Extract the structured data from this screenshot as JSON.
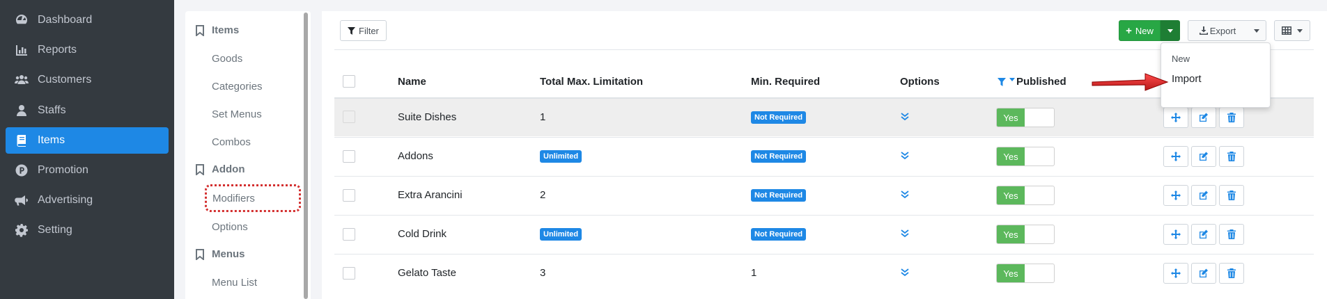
{
  "sidebar": {
    "items": [
      {
        "label": "Dashboard",
        "icon": "dashboard-icon"
      },
      {
        "label": "Reports",
        "icon": "bar-chart-icon"
      },
      {
        "label": "Customers",
        "icon": "users-icon"
      },
      {
        "label": "Staffs",
        "icon": "staff-icon"
      },
      {
        "label": "Items",
        "icon": "book-icon"
      },
      {
        "label": "Promotion",
        "icon": "promotion-icon"
      },
      {
        "label": "Advertising",
        "icon": "megaphone-icon"
      },
      {
        "label": "Setting",
        "icon": "gear-icon"
      }
    ],
    "active": "Items",
    "active_color": "#1e88e5"
  },
  "submenu": {
    "sections": [
      {
        "header": "Items",
        "items": [
          "Goods",
          "Categories",
          "Set Menus",
          "Combos"
        ]
      },
      {
        "header": "Addon",
        "items": [
          "Modifiers",
          "Options"
        ]
      },
      {
        "header": "Menus",
        "items": [
          "Menu List"
        ]
      }
    ],
    "highlighted": "Modifiers"
  },
  "toolbar": {
    "filter_label": "Filter",
    "new_label": "New",
    "export_label": "Export"
  },
  "new_dropdown": {
    "items": [
      "New",
      "Import"
    ]
  },
  "table": {
    "columns": [
      "Name",
      "Total Max. Limitation",
      "Min. Required",
      "Options",
      "Published"
    ],
    "rows": [
      {
        "name": "Suite Dishes",
        "max_limit": "1",
        "min_required": "Not Required",
        "published": "Yes"
      },
      {
        "name": "Addons",
        "max_limit": "Unlimited",
        "min_required": "Not Required",
        "published": "Yes"
      },
      {
        "name": "Extra Arancini",
        "max_limit": "2",
        "min_required": "Not Required",
        "published": "Yes"
      },
      {
        "name": "Cold Drink",
        "max_limit": "Unlimited",
        "min_required": "Not Required",
        "published": "Yes"
      },
      {
        "name": "Gelato Taste",
        "max_limit": "3",
        "min_required": "1",
        "published": "Yes"
      }
    ]
  },
  "colors": {
    "primary": "#1e88e5",
    "success": "#28a745",
    "toggle_on": "#5cb85c",
    "annotation": "#d32f2f"
  }
}
